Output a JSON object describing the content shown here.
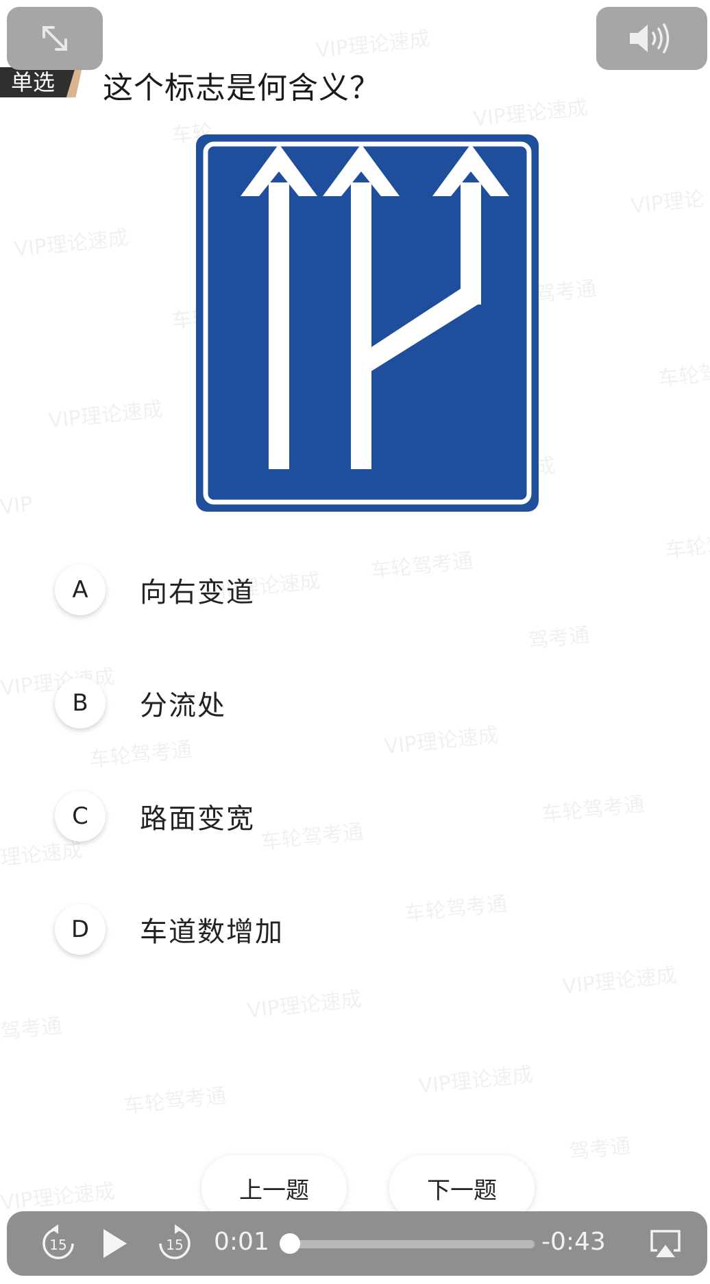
{
  "question": {
    "type_label": "单选",
    "text": "这个标志是何含义？"
  },
  "sign": {
    "background_color": "#1f4f9c",
    "border_color": "#ffffff",
    "arrow_color": "#ffffff",
    "depicts": "three-lane-arrows-with-added-right-lane"
  },
  "options": [
    {
      "letter": "A",
      "text": "向右变道"
    },
    {
      "letter": "B",
      "text": "分流处"
    },
    {
      "letter": "C",
      "text": "路面变宽"
    },
    {
      "letter": "D",
      "text": "车道数增加"
    }
  ],
  "navigation": {
    "prev_label": "上一题",
    "next_label": "下一题"
  },
  "player": {
    "skip_back_seconds": "15",
    "skip_forward_seconds": "15",
    "elapsed": "0:01",
    "remaining": "-0:43",
    "progress_fraction": 0.035
  },
  "watermarks": [
    "VIP理论速成",
    "VIP理论速成",
    "VIP理论",
    "车轮",
    "VIP理论速成",
    "驾考通",
    "车轮",
    "车轮驾考通",
    "VIP理论速成",
    "成",
    "VIP",
    "车轮驾考通",
    "VIP理论速成",
    "车轮驾考通",
    "驾考通",
    "VIP理论速成",
    "车轮驾考通",
    "VIP理论速成",
    "车轮驾考通",
    "理论速成",
    "车轮驾考通",
    "车轮驾考通",
    "VIP理论速成",
    "驾考通",
    "VIP理论速成",
    "车轮驾考通",
    "VIP理论速成",
    "驾考通",
    "VIP理论速成"
  ]
}
